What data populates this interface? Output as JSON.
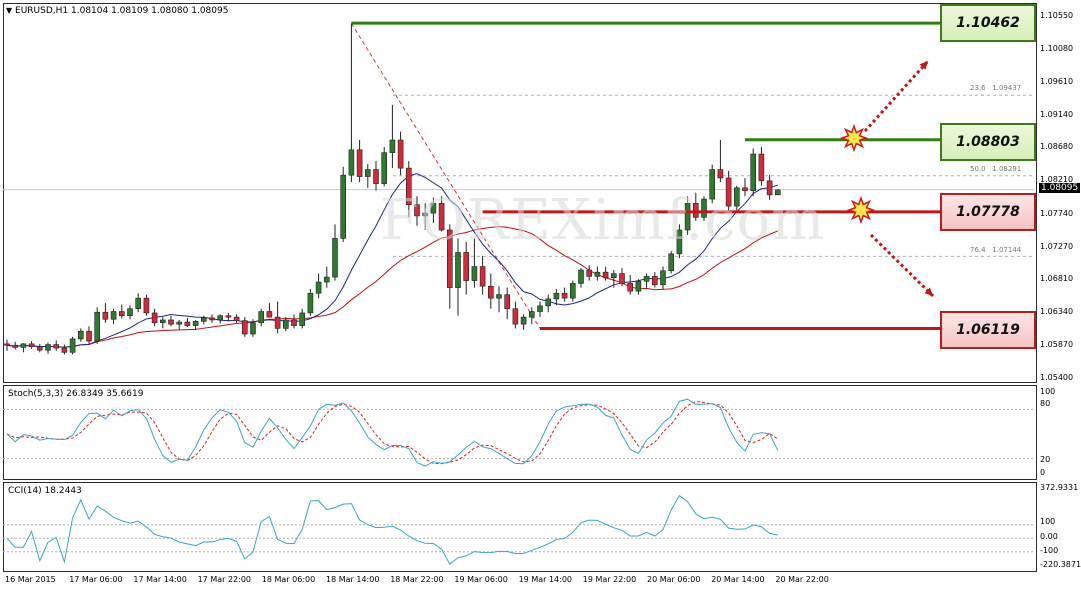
{
  "main_pane": {
    "header": "EURUSD,H1  1.08104 1.08109 1.08080 1.08095",
    "price_scale": [
      "1.10550",
      "1.10080",
      "1.09610",
      "1.09140",
      "1.08680",
      "1.08210",
      "1.07740",
      "1.07270",
      "1.06810",
      "1.06340",
      "1.05870",
      "1.05400"
    ],
    "current_price": "1.08095",
    "fib_labels": [
      {
        "pct": "23.6",
        "price": "1.09437"
      },
      {
        "pct": "50.0",
        "price": "1.08291"
      },
      {
        "pct": "76.4",
        "price": "1.07144"
      }
    ],
    "watermark": "FOREXimf.com",
    "level_boxes": [
      {
        "name": "level-box-1",
        "value": "1.10462",
        "color": "#2f7f12"
      },
      {
        "name": "level-box-2",
        "value": "1.08803",
        "color": "#2f7f12"
      },
      {
        "name": "level-box-3",
        "value": "1.07778",
        "color": "#c01818"
      },
      {
        "name": "level-box-4",
        "value": "1.06119",
        "color": "#c01818"
      }
    ]
  },
  "stoch_pane": {
    "header": "Stoch(5,3,3) 26.8349 35.6619",
    "scale": [
      "100",
      "80",
      "20",
      "0"
    ]
  },
  "cci_pane": {
    "header": "CCI(14) 18.2443",
    "scale": [
      "372.9331",
      "100",
      "0.00",
      "-100",
      "-220.3871"
    ]
  },
  "time_axis": [
    "16 Mar 2015",
    "17 Mar 06:00",
    "17 Mar 14:00",
    "17 Mar 22:00",
    "18 Mar 06:00",
    "18 Mar 14:00",
    "18 Mar 22:00",
    "19 Mar 06:00",
    "19 Mar 14:00",
    "19 Mar 22:00",
    "20 Mar 06:00",
    "20 Mar 14:00",
    "20 Mar 22:00"
  ],
  "colors": {
    "bull_candle": "#2f7a2f",
    "bear_candle": "#d12a3a",
    "ma_fast": "#1a2a8a",
    "ma_slow": "#c01010",
    "stoch_main": "#3aa6c8",
    "stoch_signal": "#e02020",
    "cci": "#3aa6c8",
    "level_green": "#2f7f12",
    "level_red": "#c01818"
  },
  "chart_data": {
    "type": "candlestick",
    "symbol": "EURUSD",
    "timeframe": "H1",
    "ylim": [
      1.054,
      1.1055
    ],
    "candles": [
      [
        1.059,
        1.0596,
        1.058,
        1.0588
      ],
      [
        1.0588,
        1.0593,
        1.0582,
        1.0585
      ],
      [
        1.0585,
        1.0591,
        1.0578,
        1.059
      ],
      [
        1.059,
        1.0594,
        1.0583,
        1.0586
      ],
      [
        1.0586,
        1.059,
        1.0578,
        1.0581
      ],
      [
        1.0581,
        1.0592,
        1.0576,
        1.0589
      ],
      [
        1.0589,
        1.0595,
        1.058,
        1.0584
      ],
      [
        1.0584,
        1.0589,
        1.0575,
        1.0578
      ],
      [
        1.0578,
        1.06,
        1.0575,
        1.0597
      ],
      [
        1.0597,
        1.0612,
        1.0593,
        1.0608
      ],
      [
        1.0608,
        1.0615,
        1.059,
        1.0594
      ],
      [
        1.0594,
        1.0642,
        1.059,
        1.0635
      ],
      [
        1.0635,
        1.0648,
        1.062,
        1.0625
      ],
      [
        1.0625,
        1.064,
        1.0618,
        1.0636
      ],
      [
        1.0636,
        1.0646,
        1.0626,
        1.063
      ],
      [
        1.063,
        1.0645,
        1.0625,
        1.064
      ],
      [
        1.064,
        1.0662,
        1.0635,
        1.0655
      ],
      [
        1.0655,
        1.066,
        1.063,
        1.0634
      ],
      [
        1.0634,
        1.064,
        1.0615,
        1.062
      ],
      [
        1.062,
        1.0628,
        1.0612,
        1.0624
      ],
      [
        1.0624,
        1.063,
        1.0615,
        1.0618
      ],
      [
        1.0618,
        1.0624,
        1.061,
        1.0621
      ],
      [
        1.0621,
        1.0627,
        1.0614,
        1.0616
      ],
      [
        1.0616,
        1.0624,
        1.061,
        1.0622
      ],
      [
        1.0622,
        1.063,
        1.0618,
        1.0627
      ],
      [
        1.0627,
        1.0632,
        1.062,
        1.0624
      ],
      [
        1.0624,
        1.0632,
        1.0619,
        1.063
      ],
      [
        1.063,
        1.0634,
        1.0622,
        1.0628
      ],
      [
        1.0628,
        1.0632,
        1.062,
        1.0623
      ],
      [
        1.0623,
        1.0628,
        1.06,
        1.0604
      ],
      [
        1.0604,
        1.0625,
        1.06,
        1.062
      ],
      [
        1.062,
        1.064,
        1.0615,
        1.0636
      ],
      [
        1.0636,
        1.0648,
        1.063,
        1.0628
      ],
      [
        1.0628,
        1.065,
        1.0605,
        1.0612
      ],
      [
        1.0612,
        1.0628,
        1.0608,
        1.0624
      ],
      [
        1.0624,
        1.0632,
        1.0612,
        1.0616
      ],
      [
        1.0616,
        1.064,
        1.0612,
        1.0634
      ],
      [
        1.0634,
        1.0668,
        1.063,
        1.0662
      ],
      [
        1.0662,
        1.069,
        1.0655,
        1.0678
      ],
      [
        1.0678,
        1.07,
        1.067,
        1.0685
      ],
      [
        1.0685,
        1.076,
        1.068,
        1.074
      ],
      [
        1.074,
        1.0842,
        1.0735,
        1.083
      ],
      [
        1.083,
        1.1046,
        1.082,
        1.0866
      ],
      [
        1.0866,
        1.088,
        1.082,
        1.0828
      ],
      [
        1.0828,
        1.0846,
        1.0812,
        1.0838
      ],
      [
        1.0838,
        1.085,
        1.0808,
        1.0818
      ],
      [
        1.0818,
        1.087,
        1.0814,
        1.0862
      ],
      [
        1.0862,
        1.093,
        1.084,
        1.088
      ],
      [
        1.088,
        1.0892,
        1.083,
        1.084
      ],
      [
        1.084,
        1.085,
        1.077,
        1.0788
      ],
      [
        1.0788,
        1.08,
        1.0758,
        1.0772
      ],
      [
        1.0772,
        1.079,
        1.0752,
        1.0776
      ],
      [
        1.0776,
        1.0798,
        1.0762,
        1.079
      ],
      [
        1.079,
        1.08,
        1.075,
        1.0752
      ],
      [
        1.0752,
        1.076,
        1.064,
        1.067
      ],
      [
        1.067,
        1.074,
        1.063,
        1.072
      ],
      [
        1.072,
        1.0735,
        1.066,
        1.068
      ],
      [
        1.068,
        1.074,
        1.067,
        1.07
      ],
      [
        1.07,
        1.0715,
        1.066,
        1.0672
      ],
      [
        1.0672,
        1.069,
        1.064,
        1.0655
      ],
      [
        1.0655,
        1.0672,
        1.0635,
        1.066
      ],
      [
        1.066,
        1.067,
        1.0625,
        1.064
      ],
      [
        1.064,
        1.065,
        1.0612,
        1.0618
      ],
      [
        1.0618,
        1.0632,
        1.061,
        1.0628
      ],
      [
        1.0628,
        1.0642,
        1.0618,
        1.0636
      ],
      [
        1.0636,
        1.065,
        1.0628,
        1.0644
      ],
      [
        1.0644,
        1.066,
        1.0635,
        1.0654
      ],
      [
        1.0654,
        1.0668,
        1.0645,
        1.0662
      ],
      [
        1.0662,
        1.067,
        1.065,
        1.0655
      ],
      [
        1.0655,
        1.068,
        1.065,
        1.0676
      ],
      [
        1.0676,
        1.0698,
        1.067,
        1.0695
      ],
      [
        1.0695,
        1.0702,
        1.068,
        1.0686
      ],
      [
        1.0686,
        1.07,
        1.068,
        1.0692
      ],
      [
        1.0692,
        1.07,
        1.068,
        1.0684
      ],
      [
        1.0684,
        1.0695,
        1.067,
        1.069
      ],
      [
        1.069,
        1.0698,
        1.0672,
        1.0676
      ],
      [
        1.0676,
        1.0688,
        1.066,
        1.0665
      ],
      [
        1.0665,
        1.0682,
        1.066,
        1.0679
      ],
      [
        1.0679,
        1.069,
        1.067,
        1.0686
      ],
      [
        1.0686,
        1.0692,
        1.067,
        1.0674
      ],
      [
        1.0674,
        1.07,
        1.0668,
        1.0694
      ],
      [
        1.0694,
        1.0722,
        1.069,
        1.0718
      ],
      [
        1.0718,
        1.076,
        1.0712,
        1.0752
      ],
      [
        1.0752,
        1.08,
        1.0745,
        1.079
      ],
      [
        1.079,
        1.0805,
        1.0765,
        1.077
      ],
      [
        1.077,
        1.08,
        1.0765,
        1.0796
      ],
      [
        1.0796,
        1.0845,
        1.079,
        1.0838
      ],
      [
        1.0838,
        1.088,
        1.082,
        1.0826
      ],
      [
        1.0826,
        1.0836,
        1.078,
        1.0786
      ],
      [
        1.0786,
        1.0815,
        1.078,
        1.0812
      ],
      [
        1.0812,
        1.0826,
        1.08,
        1.0808
      ],
      [
        1.0808,
        1.0868,
        1.08,
        1.086
      ],
      [
        1.086,
        1.087,
        1.0815,
        1.0822
      ],
      [
        1.0822,
        1.083,
        1.0795,
        1.0802
      ],
      [
        1.0802,
        1.081,
        1.0805,
        1.0809
      ]
    ],
    "levels": [
      {
        "value": 1.10462,
        "label": "1.10462"
      },
      {
        "value": 1.08803,
        "label": "1.08803"
      },
      {
        "value": 1.07778,
        "label": "1.07778"
      },
      {
        "value": 1.06119,
        "label": "1.06119"
      }
    ],
    "fibonacci": [
      {
        "pct": 23.6,
        "price": 1.09437
      },
      {
        "pct": 50.0,
        "price": 1.08291
      },
      {
        "pct": 76.4,
        "price": 1.07144
      }
    ],
    "stoch_ylim": [
      0,
      100
    ],
    "cci_ylim": [
      -220.3871,
      372.9331
    ]
  }
}
